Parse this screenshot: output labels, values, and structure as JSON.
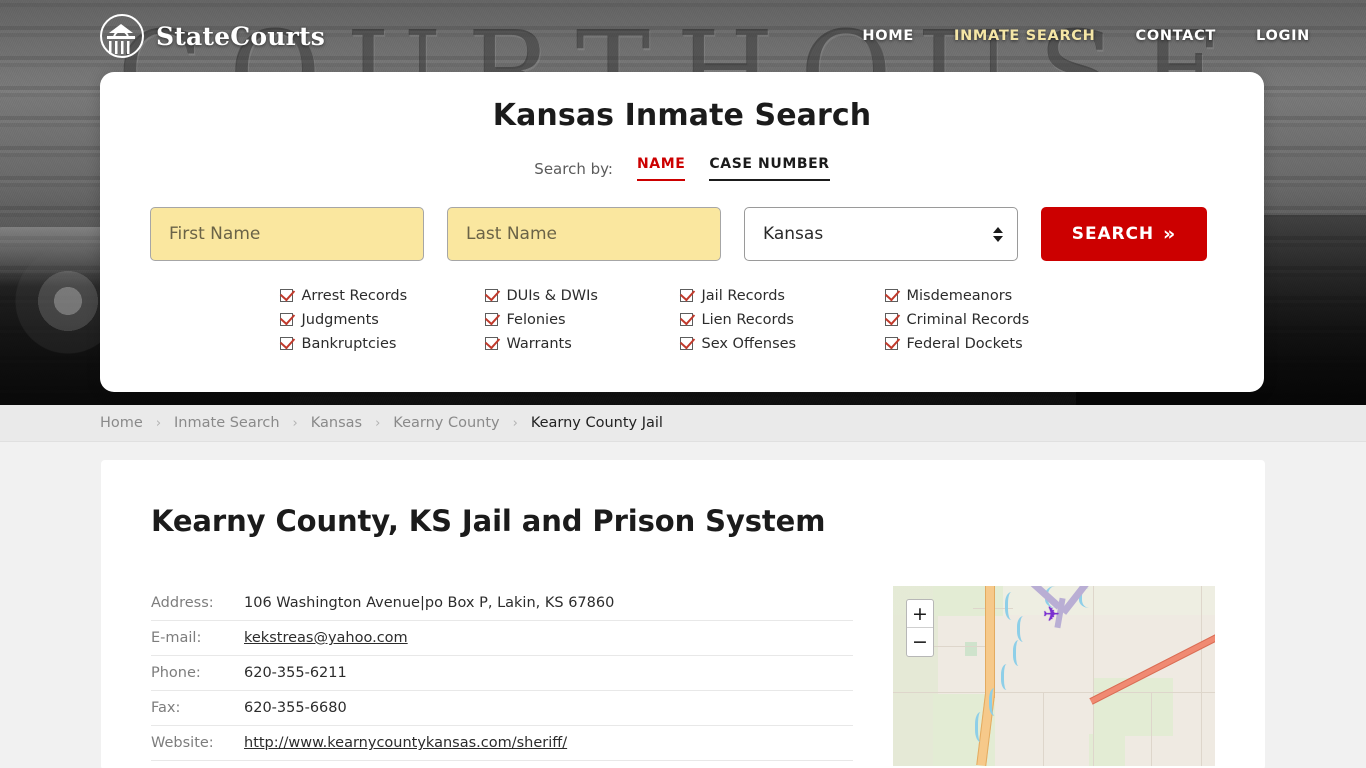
{
  "brand": {
    "name": "StateCourts",
    "logo_icon": "courthouse-circle-icon"
  },
  "nav": [
    {
      "label": "HOME",
      "active": false
    },
    {
      "label": "INMATE SEARCH",
      "active": true
    },
    {
      "label": "CONTACT",
      "active": false
    },
    {
      "label": "LOGIN",
      "active": false
    }
  ],
  "hero": {
    "backdrop_word": "COURTHOUSE"
  },
  "search": {
    "title": "Kansas Inmate Search",
    "search_by_label": "Search by:",
    "tabs": [
      {
        "label": "NAME",
        "active": true,
        "color": "#cc0000"
      },
      {
        "label": "CASE NUMBER",
        "active": false,
        "color": "#1b1b1b"
      }
    ],
    "first_name": {
      "value": "",
      "placeholder": "First Name"
    },
    "last_name": {
      "value": "",
      "placeholder": "Last Name"
    },
    "state": {
      "value": "Kansas"
    },
    "submit_label": "SEARCH",
    "submit_chevron": "»",
    "accent_color": "#cc0000",
    "field_fill": "#fae79f",
    "features": [
      "Arrest Records",
      "DUIs & DWIs",
      "Jail Records",
      "Misdemeanors",
      "Judgments",
      "Felonies",
      "Lien Records",
      "Criminal Records",
      "Bankruptcies",
      "Warrants",
      "Sex Offenses",
      "Federal Dockets"
    ]
  },
  "breadcrumb": {
    "separator": "›",
    "items": [
      {
        "label": "Home",
        "current": false
      },
      {
        "label": "Inmate Search",
        "current": false
      },
      {
        "label": "Kansas",
        "current": false
      },
      {
        "label": "Kearny County",
        "current": false
      },
      {
        "label": "Kearny County Jail",
        "current": true
      }
    ]
  },
  "main": {
    "page_title": "Kearny County, KS Jail and Prison System",
    "info_rows": [
      {
        "label": "Address:",
        "value": "106 Washington Avenue|po Box P, Lakin, KS 67860",
        "link": false
      },
      {
        "label": "E-mail:",
        "value": "kekstreas@yahoo.com",
        "link": true
      },
      {
        "label": "Phone:",
        "value": "620-355-6211",
        "link": false
      },
      {
        "label": "Fax:",
        "value": "620-355-6680",
        "link": false
      },
      {
        "label": "Website:",
        "value": "http://www.kearnycountykansas.com/sheriff/",
        "link": true
      }
    ],
    "map": {
      "zoom_in_label": "+",
      "zoom_out_label": "−",
      "airport_icon": "✈"
    }
  }
}
